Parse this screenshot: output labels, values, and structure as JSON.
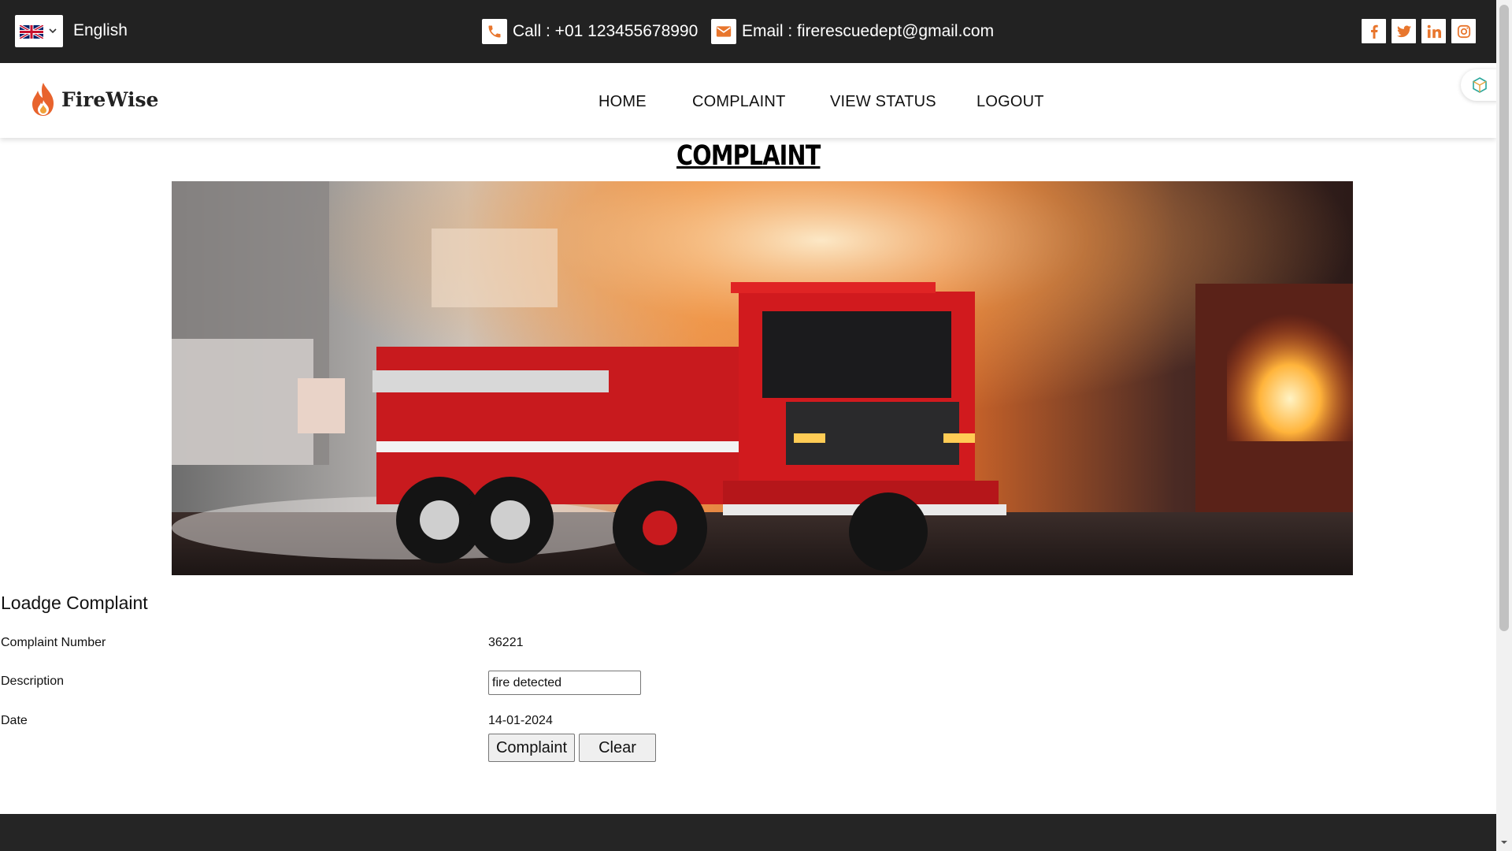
{
  "topbar": {
    "language": "English",
    "call": "Call : +01 123455678990",
    "email": "Email : firerescuedept@gmail.com",
    "social": [
      "facebook-icon",
      "twitter-icon",
      "linkedin-icon",
      "instagram-icon"
    ]
  },
  "nav": {
    "brand": "FireWise",
    "items": [
      "HOME",
      "COMPLAINT",
      "VIEW STATUS",
      "LOGOUT"
    ]
  },
  "page": {
    "title": "COMPLAINT"
  },
  "form": {
    "heading": "Loadge Complaint",
    "complaint_number_label": "Complaint Number",
    "complaint_number": "36221",
    "description_label": "Description",
    "description_value": "fire detected",
    "date_label": "Date",
    "date": "14-01-2024",
    "submit_label": "Complaint",
    "clear_label": "Clear"
  },
  "colors": {
    "topbar_bg": "#222222",
    "accent_orange": "#e8762d",
    "footer_bg": "#252525"
  }
}
